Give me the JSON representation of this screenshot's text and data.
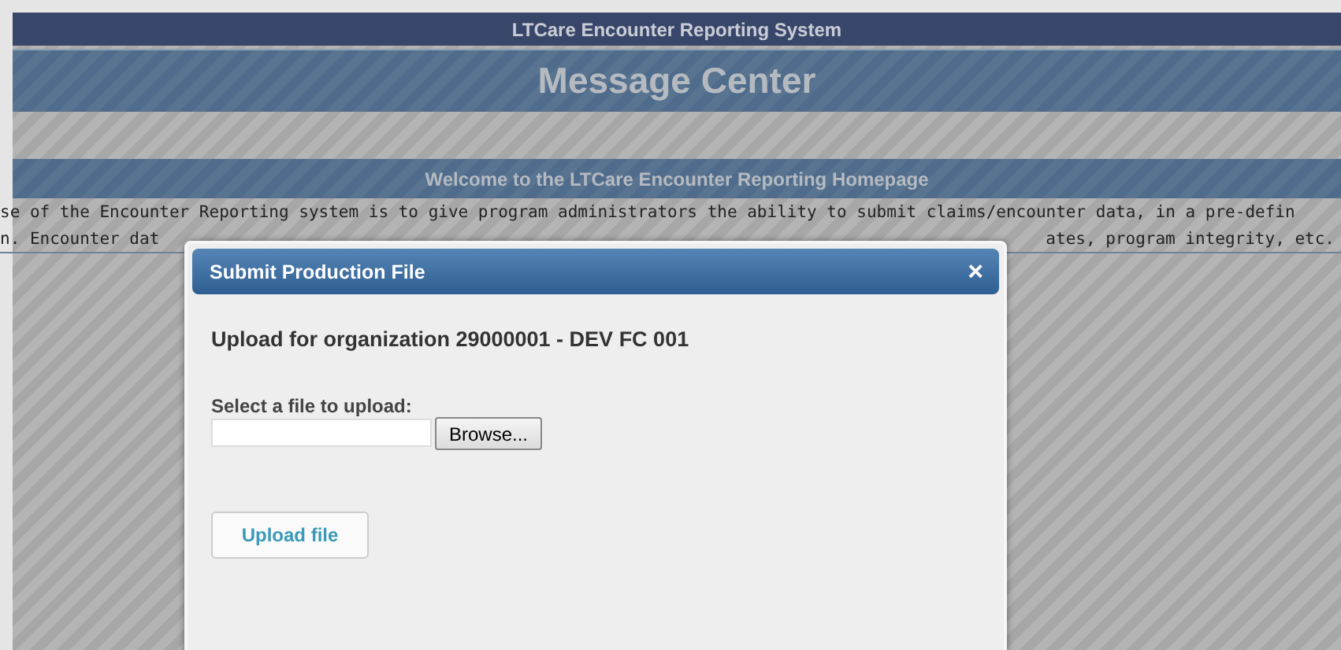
{
  "header": {
    "system_title": "LTCare Encounter Reporting System",
    "page_title": "Message Center"
  },
  "welcome": {
    "title": "Welcome to the LTCare Encounter Reporting Homepage",
    "lines": [
      [
        "se of the Encounter Reporting system is to give program administrators the ability to submit claims/encounter data, in a pre-defin"
      ],
      [
        "n. Encounter dat",
        "ates, program integrity, etc."
      ]
    ]
  },
  "dialog": {
    "title": "Submit Production File",
    "close": "×",
    "heading": "Upload for organization 29000001 - DEV FC 001",
    "file_label": "Select a file to upload:",
    "browse": "Browse...",
    "submit": "Upload file"
  }
}
